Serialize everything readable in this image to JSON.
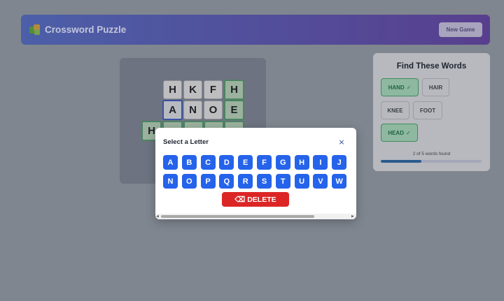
{
  "header": {
    "title": "Crossword Puzzle",
    "logo_icon": "puzzle-piece-icon",
    "new_game_label": "New Game"
  },
  "board": {
    "cells": [
      {
        "letter": "H",
        "state": "normal"
      },
      {
        "letter": "K",
        "state": "normal"
      },
      {
        "letter": "F",
        "state": "normal"
      },
      {
        "letter": "H",
        "state": "found"
      },
      {
        "letter": "A",
        "state": "selected"
      },
      {
        "letter": "N",
        "state": "normal"
      },
      {
        "letter": "O",
        "state": "normal"
      },
      {
        "letter": "E",
        "state": "found"
      },
      {
        "letter": "H",
        "state": "found"
      }
    ]
  },
  "words_panel": {
    "title": "Find These Words",
    "words": [
      {
        "label": "HAND",
        "found": true
      },
      {
        "label": "HAIR",
        "found": false
      },
      {
        "label": "KNEE",
        "found": false
      },
      {
        "label": "FOOT",
        "found": false
      },
      {
        "label": "HEAD",
        "found": true
      }
    ],
    "check_mark": "✓",
    "progress_text": "2 of 5 words found",
    "progress_fraction": 0.4
  },
  "modal": {
    "title": "Select a Letter",
    "close_label": "×",
    "letters_row1": [
      "A",
      "B",
      "C",
      "D",
      "E",
      "F",
      "G",
      "H",
      "I",
      "J"
    ],
    "letters_row2": [
      "N",
      "O",
      "P",
      "Q",
      "R",
      "S",
      "T",
      "U",
      "V",
      "W"
    ],
    "delete_icon": "⌫",
    "delete_label": "DELETE",
    "scroll_left": "◀",
    "scroll_right": "▶"
  },
  "colors": {
    "letter_button": "#2563eb",
    "delete_button": "#dc2626",
    "found_border": "#4c8462"
  }
}
